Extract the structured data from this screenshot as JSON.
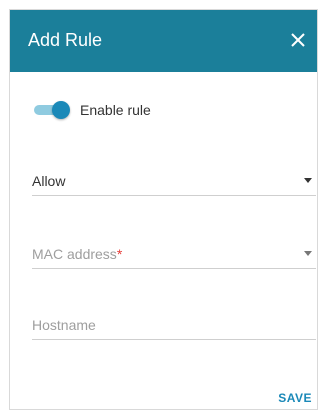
{
  "dialog": {
    "title": "Add Rule",
    "close_icon": "close-icon",
    "enable_rule": {
      "label": "Enable rule",
      "checked": true
    },
    "action_select": {
      "value": "Allow"
    },
    "mac_field": {
      "placeholder": "MAC address",
      "required_mark": "*"
    },
    "hostname_field": {
      "placeholder": "Hostname"
    },
    "save_label": "SAVE"
  },
  "colors": {
    "header": "#1b7f9a",
    "accent": "#1b89b8",
    "required": "#e53935"
  }
}
